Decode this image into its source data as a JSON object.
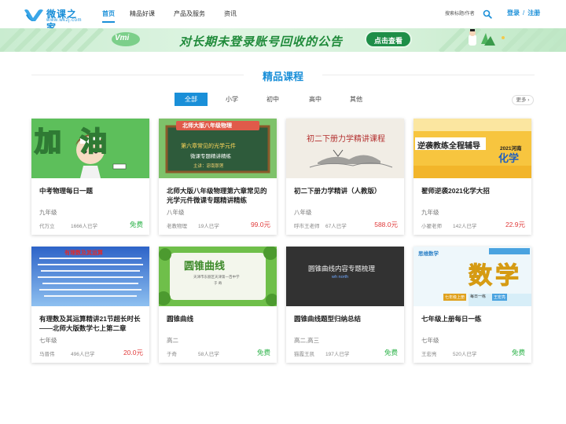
{
  "brand": {
    "name": "微课之家",
    "url": "www.wkzj.com",
    "color": "#1a8fd8"
  },
  "nav": [
    {
      "label": "首页",
      "active": true
    },
    {
      "label": "精品好课",
      "active": false
    },
    {
      "label": "产品及服务",
      "active": false
    },
    {
      "label": "资讯",
      "active": false
    }
  ],
  "search": {
    "placeholder": "搜索标题/作者",
    "icon": "search-icon"
  },
  "auth": {
    "login": "登录",
    "separator": "/",
    "register": "注册"
  },
  "banner": {
    "logo": "Vmi",
    "text": "对长期未登录账号回收的公告",
    "button": "点击查看"
  },
  "section": {
    "title": "精品课程"
  },
  "filters": [
    {
      "label": "全部",
      "active": true
    },
    {
      "label": "小学",
      "active": false
    },
    {
      "label": "初中",
      "active": false
    },
    {
      "label": "高中",
      "active": false
    },
    {
      "label": "其他",
      "active": false
    }
  ],
  "more": "更多 ›",
  "courses": [
    {
      "title": "中考物理每日一题",
      "grade": "九年级",
      "teacher": "代万立",
      "learners": "1666人已学",
      "price": "免费",
      "free": true,
      "thumb": {
        "text": "加油",
        "bg": "#5bbf5a"
      }
    },
    {
      "title": "北师大版八年级物理第六章常见的光学元件微课专题精讲精练",
      "grade": "八年级",
      "teacher": "老教物理",
      "learners": "19人已学",
      "price": "99.0元",
      "free": false,
      "thumb": {
        "text": "北师大版八年级物理",
        "line2": "第六章常见的光学元件",
        "line3": "微课专题精讲精练",
        "line4": "主讲：宓南那莲",
        "bg": "#2f5d3a"
      }
    },
    {
      "title": "初二下册力学精讲（人教版）",
      "grade": "八年级",
      "teacher": "呼市王老师",
      "learners": "67人已学",
      "price": "588.0元",
      "free": false,
      "thumb": {
        "text": "初二下册力学精讲课程",
        "bg": "#f1ece4"
      }
    },
    {
      "title": "翟师逆袭2021化学大招",
      "grade": "九年级",
      "teacher": "小翟老师",
      "learners": "142人已学",
      "price": "22.9元",
      "free": false,
      "thumb": {
        "text": "逆袭教练全程辅导",
        "right1": "2021河南",
        "right2": "化学",
        "bg": "#f6c33c"
      }
    },
    {
      "title": "有理数及其运算精讲21节超长时长——北师大版数学七上第二章",
      "grade": "七年级",
      "teacher": "马晋伟",
      "learners": "496人已学",
      "price": "20.0元",
      "free": false,
      "thumb": {
        "text": "有理数及其运算",
        "bg": "#3f7bd8"
      }
    },
    {
      "title": "圆锥曲线",
      "grade": "高二",
      "teacher": "于奇",
      "learners": "58人已学",
      "price": "免费",
      "free": true,
      "thumb": {
        "text": "圆锥曲线",
        "sub": "天津市东丽区天津第一百中学",
        "sub2": "于 奇",
        "bg": "#eef4e4"
      }
    },
    {
      "title": "圆锥曲线题型归纳总结",
      "grade": "高二,高三",
      "teacher": "猫霞王凯",
      "learners": "197人已学",
      "price": "免费",
      "free": true,
      "thumb": {
        "text": "圆锥曲线内容专题梳理",
        "sub": "wh north",
        "bg": "#2e2e2e"
      }
    },
    {
      "title": "七年级上册每日一练",
      "grade": "七年级",
      "teacher": "王宏亮",
      "learners": "520人已学",
      "price": "免费",
      "free": true,
      "thumb": {
        "text": "数学",
        "brand": "思维数学",
        "tag1": "七年级上册",
        "tag2": "每日一练",
        "tag3": "王宏亮",
        "bg": "#eaf6fb"
      }
    }
  ]
}
